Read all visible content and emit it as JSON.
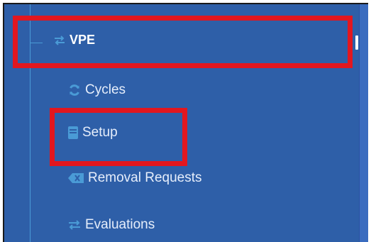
{
  "nav": {
    "parent": {
      "label": "VPE",
      "icon": "swap-arrows-icon"
    },
    "items": [
      {
        "label": "Cycles",
        "icon": "refresh-icon"
      },
      {
        "label": "Setup",
        "icon": "book-icon"
      },
      {
        "label": "Removal Requests",
        "icon": "backspace-icon"
      },
      {
        "label": "Evaluations",
        "icon": "swap-arrows-icon"
      }
    ]
  },
  "colors": {
    "panel_bg": "#2e5fa8",
    "icon_accent": "#4a9bd6",
    "highlight_red": "#e2171f"
  }
}
